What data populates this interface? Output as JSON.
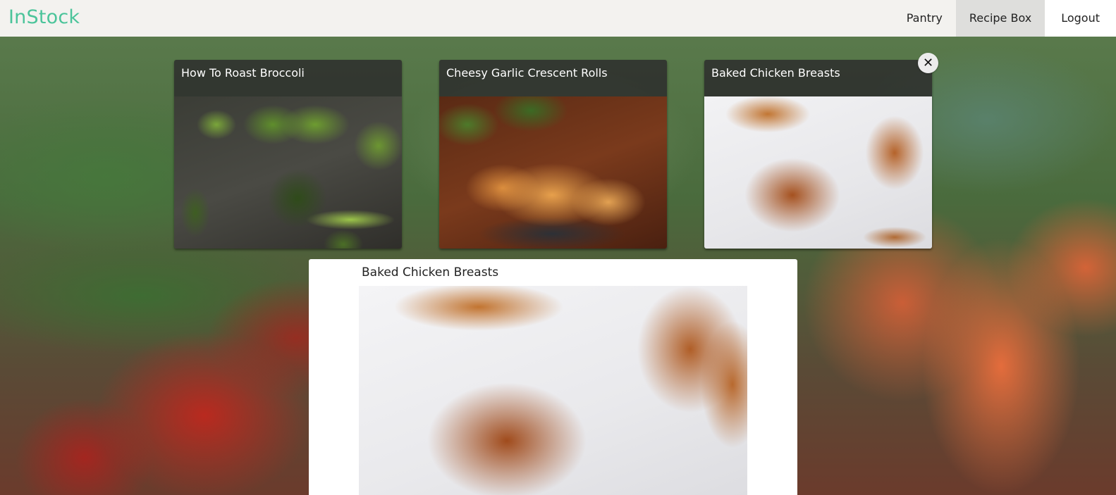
{
  "app": {
    "title": "InStock"
  },
  "nav": {
    "items": [
      {
        "label": "Pantry"
      },
      {
        "label": "Recipe Box"
      },
      {
        "label": "Logout"
      }
    ]
  },
  "recipes": [
    {
      "title": "How To Roast Broccoli"
    },
    {
      "title": "Cheesy Garlic Crescent Rolls"
    },
    {
      "title": "Baked Chicken Breasts"
    }
  ],
  "close": {
    "icon": "close-icon",
    "glyph": "✕"
  },
  "detail": {
    "title": "Baked Chicken Breasts"
  },
  "colors": {
    "brand": "#4bc49a",
    "header_bg": "#f3f2ef",
    "active_nav": "#dededc"
  }
}
